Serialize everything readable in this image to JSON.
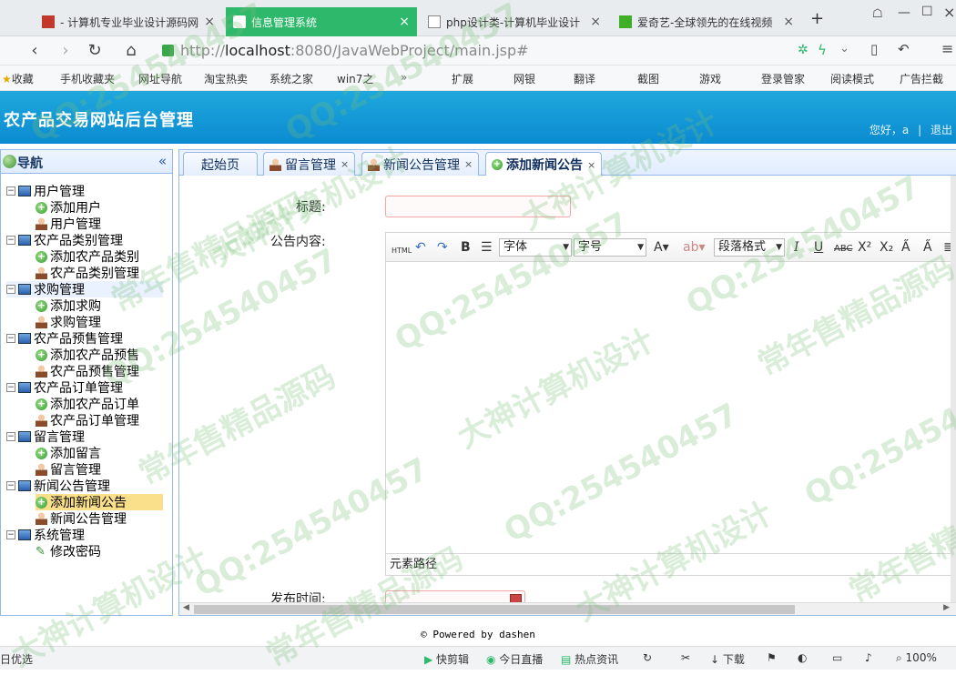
{
  "browser": {
    "tabs": [
      {
        "label": "- 计算机专业毕业设计源码网"
      },
      {
        "label": "信息管理系统"
      },
      {
        "label": "php设计类-计算机毕业设计"
      },
      {
        "label": "爱奇艺-全球领先的在线视频"
      }
    ],
    "new_tab": "+",
    "url_prefix": "http://",
    "url_host": "localhost",
    "url_rest": ":8080/JavaWebProject/main.jsp#",
    "bookmarks": [
      "收藏",
      "手机收藏夹",
      "网址导航",
      "淘宝热卖",
      "系统之家",
      "win7之",
      "扩展",
      "网银",
      "翻译",
      "截图",
      "游戏",
      "登录管家",
      "阅读模式",
      "广告拦截"
    ]
  },
  "app": {
    "title": "农产品交易网站后台管理",
    "greeting": "您好，a",
    "logout": "退出"
  },
  "sidebar": {
    "title": "导航",
    "groups": [
      {
        "label": "用户管理",
        "items": [
          "添加用户",
          "用户管理"
        ]
      },
      {
        "label": "农产品类别管理",
        "items": [
          "添加农产品类别",
          "农产品类别管理"
        ]
      },
      {
        "label": "求购管理",
        "items": [
          "添加求购",
          "求购管理"
        ]
      },
      {
        "label": "农产品预售管理",
        "items": [
          "添加农产品预售",
          "农产品预售管理"
        ]
      },
      {
        "label": "农产品订单管理",
        "items": [
          "添加农产品订单",
          "农产品订单管理"
        ]
      },
      {
        "label": "留言管理",
        "items": [
          "添加留言",
          "留言管理"
        ]
      },
      {
        "label": "新闻公告管理",
        "items": [
          "添加新闻公告",
          "新闻公告管理"
        ]
      },
      {
        "label": "系统管理",
        "items": [
          "修改密码"
        ]
      }
    ]
  },
  "tabs": [
    {
      "label": "起始页"
    },
    {
      "label": "留言管理"
    },
    {
      "label": "新闻公告管理"
    },
    {
      "label": "添加新闻公告"
    }
  ],
  "form": {
    "title_label": "标题:",
    "content_label": "公告内容:",
    "date_label": "发布时间:",
    "editor": {
      "font_family": "字体",
      "font_size": "字号",
      "paragraph": "段落格式",
      "path_label": "元素路径"
    }
  },
  "footer": "© Powered by dashen",
  "statusbar": [
    "日优选",
    "快剪辑",
    "今日直播",
    "热点资讯",
    "下载",
    "100%"
  ],
  "watermarks": [
    "QQ:254540457",
    "大神计算机设计",
    "常年售精品源码"
  ]
}
